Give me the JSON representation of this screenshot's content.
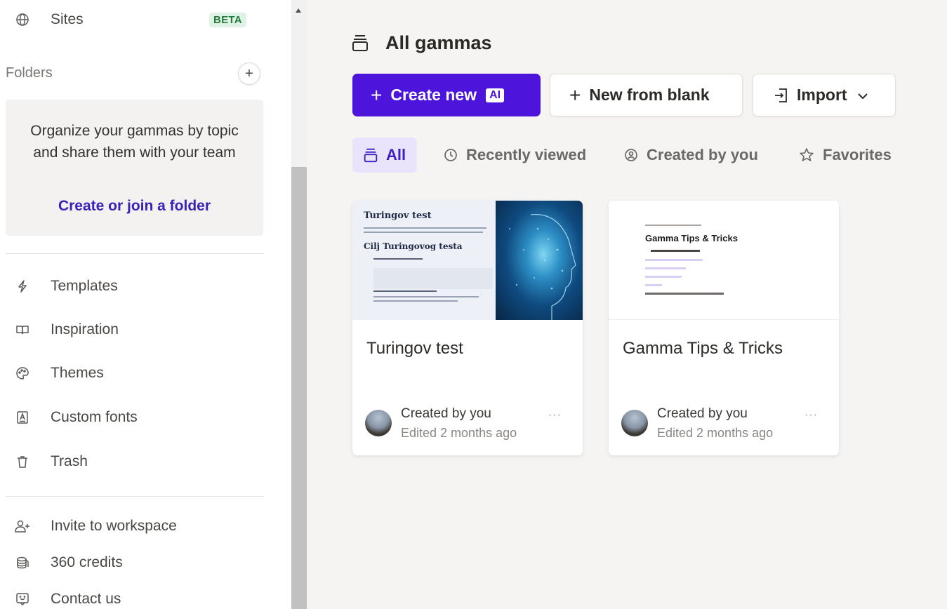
{
  "sidebar": {
    "sites": {
      "label": "Sites",
      "badge": "BETA",
      "icon": "globe-icon"
    },
    "folders": {
      "heading": "Folders",
      "add_icon": "plus-icon",
      "empty_text": "Organize your gammas by topic and share them with your team",
      "cta": "Create or join a folder"
    },
    "items": [
      {
        "label": "Templates",
        "icon": "lightning-icon"
      },
      {
        "label": "Inspiration",
        "icon": "book-icon"
      },
      {
        "label": "Themes",
        "icon": "palette-icon"
      },
      {
        "label": "Custom fonts",
        "icon": "font-icon"
      },
      {
        "label": "Trash",
        "icon": "trash-icon"
      }
    ],
    "footer": [
      {
        "label": "Invite to workspace",
        "icon": "user-plus-icon"
      },
      {
        "label": "360 credits",
        "icon": "coins-icon"
      },
      {
        "label": "Contact us",
        "icon": "chat-icon"
      }
    ]
  },
  "main": {
    "title": "All gammas",
    "buttons": {
      "create": "Create new",
      "ai_badge": "AI",
      "blank": "New from blank",
      "import": "Import"
    },
    "tabs": [
      {
        "label": "All",
        "active": true
      },
      {
        "label": "Recently viewed",
        "active": false
      },
      {
        "label": "Created by you",
        "active": false
      },
      {
        "label": "Favorites",
        "active": false
      }
    ],
    "cards": [
      {
        "title": "Turingov test",
        "created": "Created by you",
        "edited": "Edited 2 months ago",
        "thumb": {
          "heading": "Turingov test",
          "subheading": "Cilj Turingovog testa"
        }
      },
      {
        "title": "Gamma Tips & Tricks",
        "created": "Created by you",
        "edited": "Edited 2 months ago",
        "thumb": {
          "heading": "Gamma Tips & Tricks"
        }
      }
    ],
    "more_label": "···"
  },
  "colors": {
    "accent": "#4d14dc",
    "link": "#3b21b7",
    "beta_bg": "#dff3e4",
    "beta_fg": "#257a3e",
    "tab_active_bg": "#e9e4fb"
  }
}
